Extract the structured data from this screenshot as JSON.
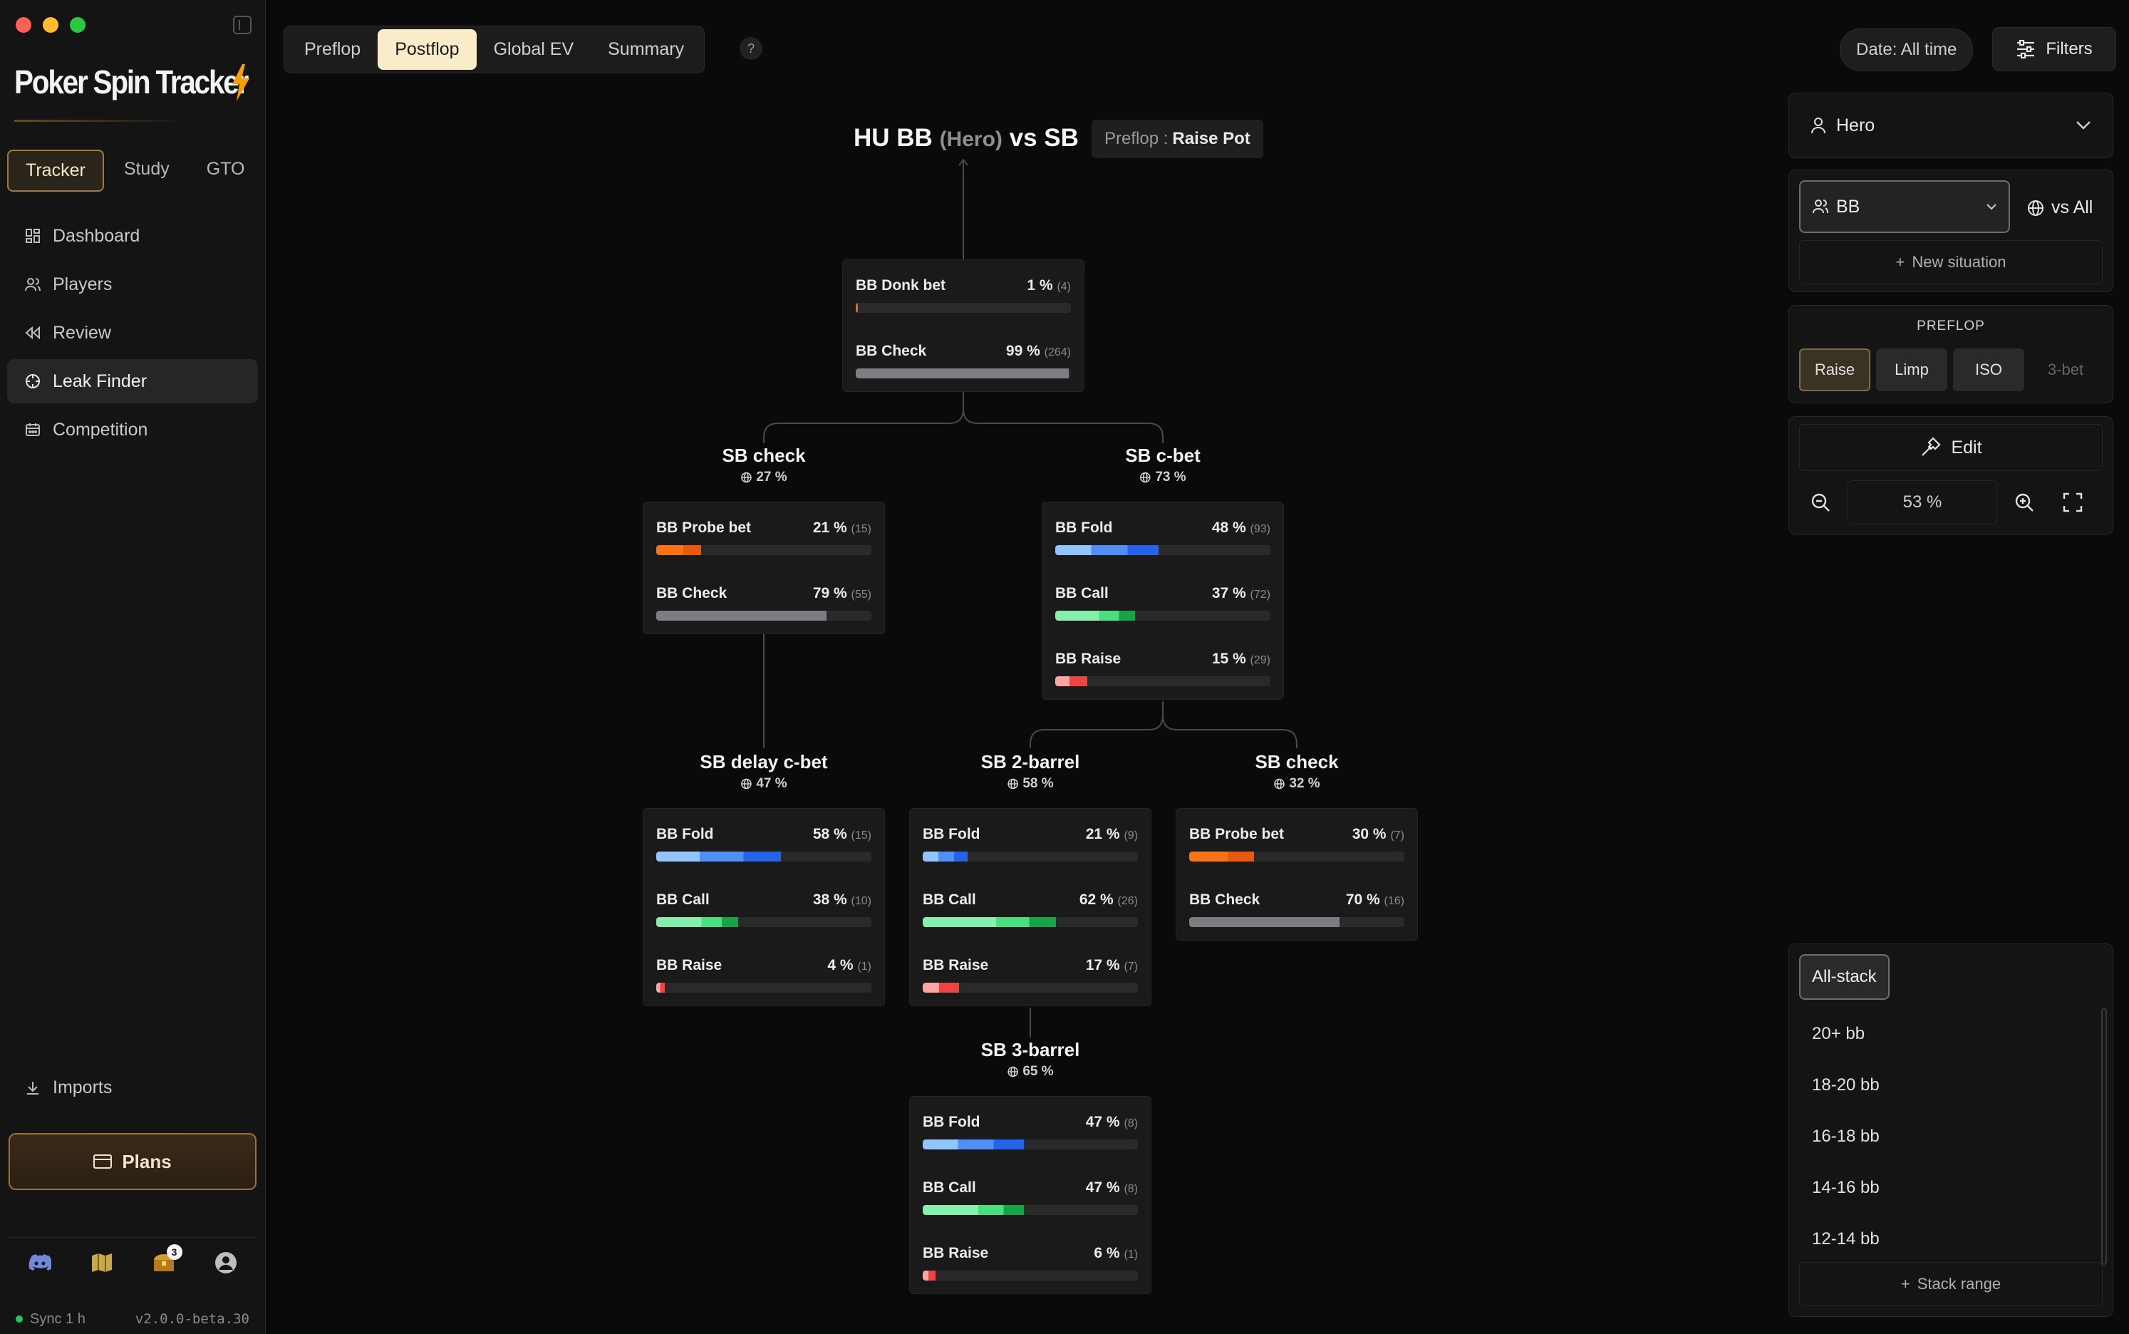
{
  "sidebar": {
    "logo": "Poker Spin Tracker",
    "mode_tabs": [
      "Tracker",
      "Study",
      "GTO"
    ],
    "nav": [
      {
        "label": "Dashboard",
        "icon": "dashboard-icon"
      },
      {
        "label": "Players",
        "icon": "players-icon"
      },
      {
        "label": "Review",
        "icon": "review-icon"
      },
      {
        "label": "Leak Finder",
        "icon": "leak-finder-icon"
      },
      {
        "label": "Competition",
        "icon": "competition-icon"
      }
    ],
    "imports": "Imports",
    "plans": "Plans",
    "notification_count": "3",
    "sync": "Sync 1 h",
    "version": "v2.0.0-beta.30"
  },
  "top_tabs": [
    "Preflop",
    "Postflop",
    "Global EV",
    "Summary"
  ],
  "help": "?",
  "date_filter": "Date: All time",
  "filters": "Filters",
  "tree": {
    "title_main": "HU BB",
    "title_hero": "(Hero)",
    "title_vs": "vs SB",
    "chip_prefix": "Preflop :",
    "chip_value": "Raise Pot",
    "root": {
      "rows": [
        {
          "label": "BB Donk bet",
          "pct": 1,
          "pct_text": "1 %",
          "count": "(4)",
          "color": "orange"
        },
        {
          "label": "BB Check",
          "pct": 99,
          "pct_text": "99 %",
          "count": "(264)",
          "color": "gray"
        }
      ]
    },
    "sb_check": {
      "title": "SB check",
      "freq": "27 %",
      "rows": [
        {
          "label": "BB Probe bet",
          "pct": 21,
          "pct_text": "21 %",
          "count": "(15)",
          "color": "orange"
        },
        {
          "label": "BB Check",
          "pct": 79,
          "pct_text": "79 %",
          "count": "(55)",
          "color": "gray"
        }
      ]
    },
    "sb_cbet": {
      "title": "SB c-bet",
      "freq": "73 %",
      "rows": [
        {
          "label": "BB Fold",
          "pct": 48,
          "pct_text": "48 %",
          "count": "(93)",
          "color": "blue"
        },
        {
          "label": "BB Call",
          "pct": 37,
          "pct_text": "37 %",
          "count": "(72)",
          "color": "green"
        },
        {
          "label": "BB Raise",
          "pct": 15,
          "pct_text": "15 %",
          "count": "(29)",
          "color": "red"
        }
      ]
    },
    "sb_delay_cbet": {
      "title": "SB delay c-bet",
      "freq": "47 %",
      "rows": [
        {
          "label": "BB Fold",
          "pct": 58,
          "pct_text": "58 %",
          "count": "(15)",
          "color": "blue"
        },
        {
          "label": "BB Call",
          "pct": 38,
          "pct_text": "38 %",
          "count": "(10)",
          "color": "green"
        },
        {
          "label": "BB Raise",
          "pct": 4,
          "pct_text": "4 %",
          "count": "(1)",
          "color": "red"
        }
      ]
    },
    "sb_2barrel": {
      "title": "SB 2-barrel",
      "freq": "58 %",
      "rows": [
        {
          "label": "BB Fold",
          "pct": 21,
          "pct_text": "21 %",
          "count": "(9)",
          "color": "blue"
        },
        {
          "label": "BB Call",
          "pct": 62,
          "pct_text": "62 %",
          "count": "(26)",
          "color": "green"
        },
        {
          "label": "BB Raise",
          "pct": 17,
          "pct_text": "17 %",
          "count": "(7)",
          "color": "red"
        }
      ]
    },
    "sb_check2": {
      "title": "SB check",
      "freq": "32 %",
      "rows": [
        {
          "label": "BB Probe bet",
          "pct": 30,
          "pct_text": "30 %",
          "count": "(7)",
          "color": "orange"
        },
        {
          "label": "BB Check",
          "pct": 70,
          "pct_text": "70 %",
          "count": "(16)",
          "color": "gray"
        }
      ]
    },
    "sb_3barrel": {
      "title": "SB 3-barrel",
      "freq": "65 %",
      "rows": [
        {
          "label": "BB Fold",
          "pct": 47,
          "pct_text": "47 %",
          "count": "(8)",
          "color": "blue"
        },
        {
          "label": "BB Call",
          "pct": 47,
          "pct_text": "47 %",
          "count": "(8)",
          "color": "green"
        },
        {
          "label": "BB Raise",
          "pct": 6,
          "pct_text": "6 %",
          "count": "(1)",
          "color": "red"
        }
      ]
    }
  },
  "right": {
    "player": "Hero",
    "position": "BB",
    "vs": "vs All",
    "new_situation": "New situation",
    "preflop_label": "PREFLOP",
    "preflop_actions": [
      "Raise",
      "Limp",
      "ISO",
      "3-bet"
    ],
    "edit": "Edit",
    "zoom": "53 %",
    "stack_selected": "All-stack",
    "stacks": [
      "20+ bb",
      "18-20 bb",
      "16-18 bb",
      "14-16 bb",
      "12-14 bb"
    ],
    "stack_range": "Stack range"
  }
}
